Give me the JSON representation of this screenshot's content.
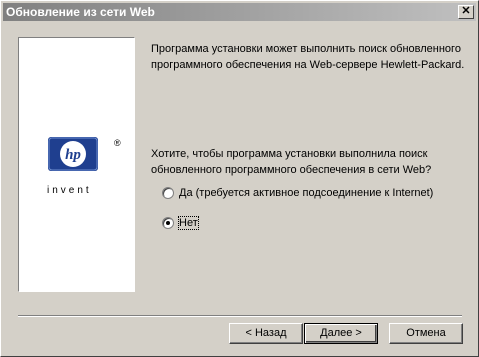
{
  "window": {
    "title": "Обновление из сети Web"
  },
  "logo": {
    "brand": "hp",
    "tagline": "invent",
    "reg": "®"
  },
  "content": {
    "intro": "Программа установки может выполнить поиск обновленного программного обеспечения на Web-сервере Hewlett-Packard.",
    "question": "Хотите, чтобы программа установки выполнила поиск обновленного программного обеспечения в сети Web?",
    "options": [
      {
        "label": "Да (требуется активное подсоединение к Internet)",
        "selected": false
      },
      {
        "label": "Нет",
        "selected": true
      }
    ]
  },
  "buttons": {
    "back": "< Назад",
    "next": "Далее >",
    "cancel": "Отмена"
  },
  "colors": {
    "hp_blue": "#1f3f8f"
  }
}
